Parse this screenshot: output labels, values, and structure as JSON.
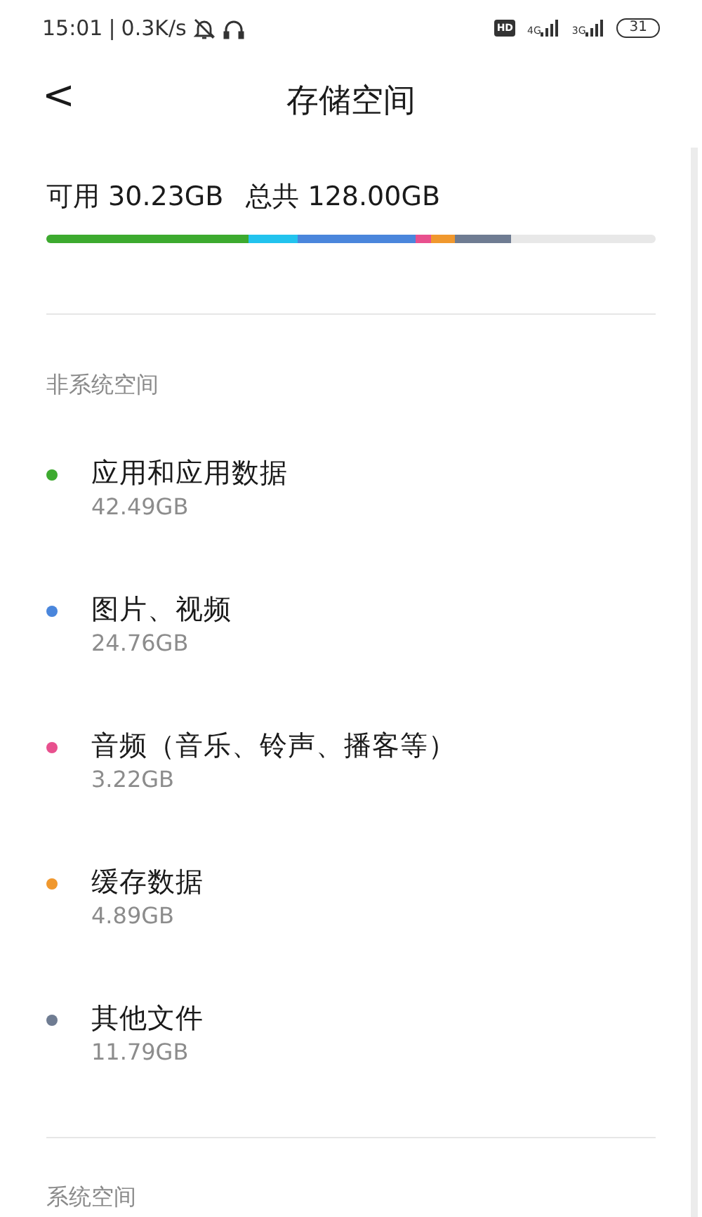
{
  "status_bar": {
    "time": "15:01",
    "separator": "|",
    "speed": "0.3K/s",
    "hd": "HD",
    "network_1": "4G",
    "network_2": "3G",
    "battery": "31"
  },
  "header": {
    "back": "<",
    "title": "存储空间"
  },
  "summary": {
    "available_label": "可用",
    "available": "30.23GB",
    "total_label": "总共",
    "total": "128.00GB"
  },
  "storage_bar": {
    "segments": [
      {
        "color": "#3daa2f"
      },
      {
        "color": "#22c3ee"
      },
      {
        "color": "#4a86dc"
      },
      {
        "color": "#e8508e"
      },
      {
        "color": "#f0982e"
      },
      {
        "color": "#6f7c92"
      }
    ]
  },
  "sections": [
    {
      "label": "非系统空间",
      "items": [
        {
          "name": "应用和应用数据",
          "size": "42.49GB",
          "color": "#3daa2f"
        },
        {
          "name": "图片、视频",
          "size": "24.76GB",
          "color": "#4a86dc"
        },
        {
          "name": "音频（音乐、铃声、播客等）",
          "size": "3.22GB",
          "color": "#e8508e"
        },
        {
          "name": "缓存数据",
          "size": "4.89GB",
          "color": "#f0982e"
        },
        {
          "name": "其他文件",
          "size": "11.79GB",
          "color": "#6f7c92"
        }
      ]
    },
    {
      "label": "系统空间"
    }
  ]
}
